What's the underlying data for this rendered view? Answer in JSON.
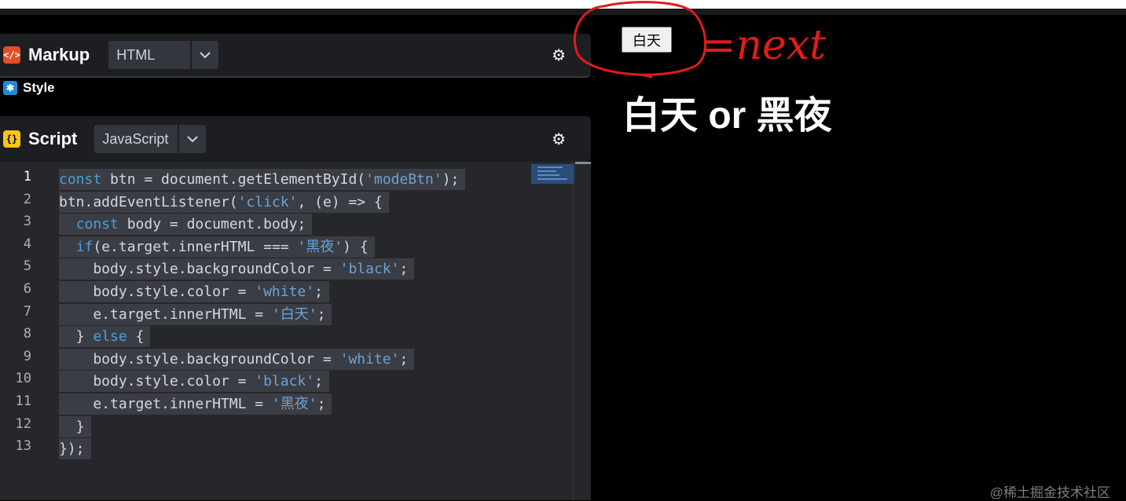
{
  "markup": {
    "title": "Markup",
    "language": "HTML",
    "icon": "html-icon"
  },
  "style": {
    "title": "Style",
    "icon": "asterisk-icon"
  },
  "script": {
    "title": "Script",
    "language": "JavaScript",
    "icon": "js-icon",
    "line_numbers": [
      "1",
      "2",
      "3",
      "4",
      "5",
      "6",
      "7",
      "8",
      "9",
      "10",
      "11",
      "12",
      "13"
    ],
    "lines": [
      "const btn = document.getElementById('modeBtn');",
      "btn.addEventListener('click', (e) => {",
      "  const body = document.body;",
      "  if(e.target.innerHTML === '黑夜') {",
      "    body.style.backgroundColor = 'black';",
      "    body.style.color = 'white';",
      "    e.target.innerHTML = '白天';",
      "  } else {",
      "    body.style.backgroundColor = 'white';",
      "    body.style.color = 'black';",
      "    e.target.innerHTML = '黑夜';",
      "  }",
      "});"
    ]
  },
  "preview": {
    "button_label": "白天",
    "heading": "白天 or 黑夜",
    "annotation": "=next"
  },
  "watermark": "@稀土掘金技术社区",
  "colors": {
    "editor_bg": "#26272b",
    "keyword": "#4a9fd8",
    "string": "#6aa3d8",
    "annotation": "#e11b1b"
  }
}
